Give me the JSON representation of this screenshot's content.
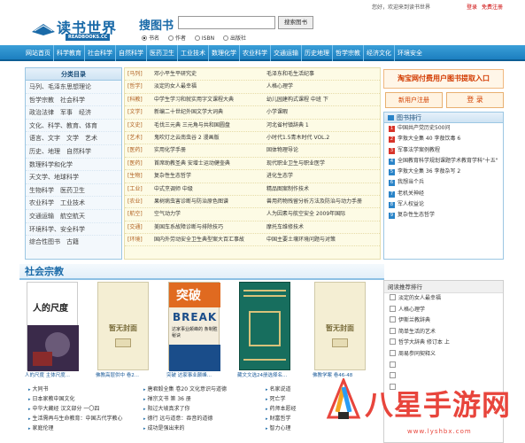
{
  "topbar": {
    "welcome": "您好，欢迎来到读书世界",
    "login": "登录",
    "register": "免费注册"
  },
  "logo": {
    "text": "读书世界",
    "sub": "READBOOKS.CC"
  },
  "search": {
    "title": "搜图书",
    "button": "搜索图书",
    "options": [
      "书名",
      "作者",
      "ISBN",
      "出版社"
    ],
    "selected": "书名"
  },
  "nav": [
    "网站首页",
    "科学教育",
    "社会科学",
    "自然科学",
    "医药卫生",
    "工业技术",
    "数理化学",
    "农业科学",
    "交通运输",
    "历史地理",
    "哲学宗教",
    "经济文化",
    "环境安全"
  ],
  "categories": {
    "title": "分类目录",
    "rows": [
      "马列、毛泽东思想理论",
      "哲学宗教　社会科学",
      "政治法律　军事　经济",
      "文化、科学、教育、体育",
      "语言、文字　文学　艺术",
      "历史、地理　自然科学",
      "数理科学和化学",
      "天文学、地球科学",
      "生物科学　医药卫生",
      "农业科学　工业技术",
      "交通运输　航空航天",
      "环境科学、安全科学",
      "综合性图书　古籍"
    ]
  },
  "book_list": [
    {
      "tag": "[马列]",
      "a": "邓小平生平研究史",
      "b": "毛泽东和毛生活纪事"
    },
    {
      "tag": "[哲学]",
      "a": "淡定的女人最幸福",
      "b": "人格心理学"
    },
    {
      "tag": "[科教]",
      "a": "中学生学习和就实用字文课程大典",
      "b": "幼儿园建构式课程 中班 下"
    },
    {
      "tag": "[文学]",
      "a": "新编二十世纪外国文学大词典",
      "b": "小学课暇"
    },
    {
      "tag": "[文史]",
      "a": "毛伐三元典 三元角与共和国圆盘",
      "b": "河北省村镇辞典 1"
    },
    {
      "tag": "[艺术]",
      "a": "鬼吹灯之云南虫谷 2 漫画版",
      "b": "小时代1.5青木时代 VOL.2"
    },
    {
      "tag": "[医药]",
      "a": "实用化学手册",
      "b": "固体物理导论"
    },
    {
      "tag": "[医药]",
      "a": "首席助教圣典 安增士运动健壶典",
      "b": "现代职业卫生与职业医学"
    },
    {
      "tag": "[生物]",
      "a": "复杂性生态哲学",
      "b": "进化生态学"
    },
    {
      "tag": "[工业]",
      "a": "中式烹调师 中级",
      "b": "精品图案制作技术"
    },
    {
      "tag": "[农业]",
      "a": "果树病虫害诊断与防治原色图谱",
      "b": "兽用药物残留分析方法及防治与动力手册"
    },
    {
      "tag": "[航空]",
      "a": "空气动力学",
      "b": "人为因素与航空安全 2009年国际"
    },
    {
      "tag": "[交通]",
      "a": "美国车系故障诊断与排除技巧",
      "b": "摩托车维修技术"
    },
    {
      "tag": "[环境]",
      "a": "国内外劳动安全卫生典型案大百汇事故",
      "b": "中国主要土壤环境问题与对策"
    }
  ],
  "promo": "淘宝网付费用户图书提取入口",
  "user_center": "新用户注册",
  "login_btn": "登 录",
  "rank": {
    "title": "图书排行",
    "rows": [
      "中国共产党历史500问",
      "李敖大全集 40 李敖饮毒 6",
      "军事法学案例教程",
      "全国教育科学规划课题学术教育学科\"十五\"",
      "李敖大全集 36 李敖杂写 2",
      "我想当个兵",
      "老机关神经",
      "军人权益论",
      "复杂性生态哲学"
    ]
  },
  "social": {
    "title": "社会宗教"
  },
  "covers": [
    {
      "kind": "image",
      "title": "人的尺度",
      "caption": "人的尺度 主体尺度..."
    },
    {
      "kind": "none",
      "label": "暂无封面",
      "caption": "佛教高层供中 卷2..."
    },
    {
      "kind": "image",
      "title": "突破 BREAK",
      "sub": "达家事业颠峰的 条制胜秘诀",
      "caption": "突破 达家事业颠峰..."
    },
    {
      "kind": "tibet",
      "caption": "藏文文选24册选择名..."
    },
    {
      "kind": "none",
      "label": "暂无封面",
      "caption": "佛教学案 卷46-48"
    }
  ],
  "bottom": {
    "col1": [
      "大同书",
      "日本家教中国文化",
      "中华大藏经 汉文部分 一〇四",
      "生活需再与生命教育：中国古代学教心",
      "家庭伦理"
    ],
    "col2": [
      "唐君毅全集 卷20 文化意识与道德",
      "禅宗文书 第 36 册",
      "阳过大坡真求了你",
      "德行 远与道意：吞音的道德",
      "成功是强出来的"
    ],
    "col3": [
      "名家说道",
      "死亡学",
      "药师本愿经",
      "财富哲学",
      "智力心理"
    ]
  },
  "recommend": {
    "title": "阅读推荐排行",
    "rows": [
      "淡定的女人最幸福",
      "人格心理学",
      "伊斯兰教辞典",
      "简单生活的艺术",
      "哲学大辞典 修订本 上",
      "周易参同契释义",
      "",
      "",
      ""
    ]
  },
  "watermark": {
    "text": "八星手游网",
    "url": "www.lyshbx.com"
  },
  "colors": {
    "nav": "#1c7fc0",
    "accent": "#1a6aa8",
    "promo": "#d23a00",
    "watermark": "#e8453c"
  }
}
